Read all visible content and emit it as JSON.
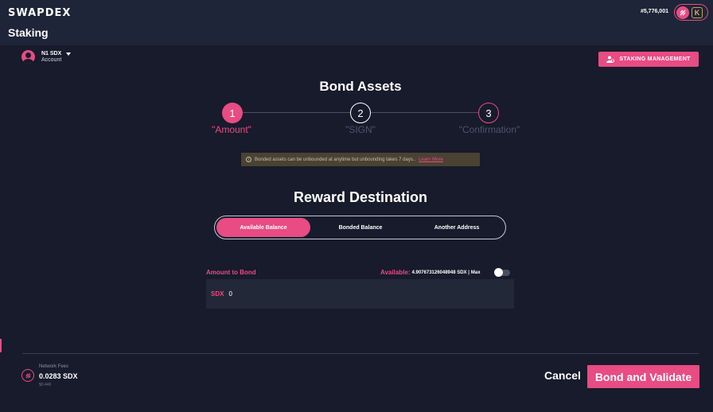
{
  "header": {
    "logo": "SWAPDEX",
    "title": "Staking",
    "balance": "#5,776,001",
    "wallet_k_label": "K"
  },
  "account": {
    "name": "N1 SDX",
    "subtitle": "Account"
  },
  "staking_management_label": "STAKING MANAGEMENT",
  "bond": {
    "title": "Bond Assets",
    "steps": [
      {
        "number": "1",
        "label": "\"Amount\"",
        "active": true
      },
      {
        "number": "2",
        "label": "\"SIGN\"",
        "active": false
      },
      {
        "number": "3",
        "label": "\"Confirmation\"",
        "active": false
      }
    ],
    "notice_text": "Bonded assets can be unbounded at anytime but unbounding takes 7 days..",
    "notice_link": "Learn More"
  },
  "reward": {
    "title": "Reward Destination",
    "options": [
      "Available Balance",
      "Bonded Balance",
      "Another Address"
    ],
    "selected": "Available Balance"
  },
  "amount": {
    "label": "Amount to Bond",
    "available_label": "Available:",
    "available_value": "4.907673126048948 SDX |",
    "max_label": "Max",
    "currency": "SDX",
    "value": "0"
  },
  "fees": {
    "label": "Network Fees",
    "value": "0.0283 SDX",
    "usd": "$0.446"
  },
  "actions": {
    "cancel": "Cancel",
    "submit": "Bond and Validate"
  },
  "colors": {
    "accent": "#e94b83",
    "background": "#171b2b",
    "header": "#1e2538"
  }
}
